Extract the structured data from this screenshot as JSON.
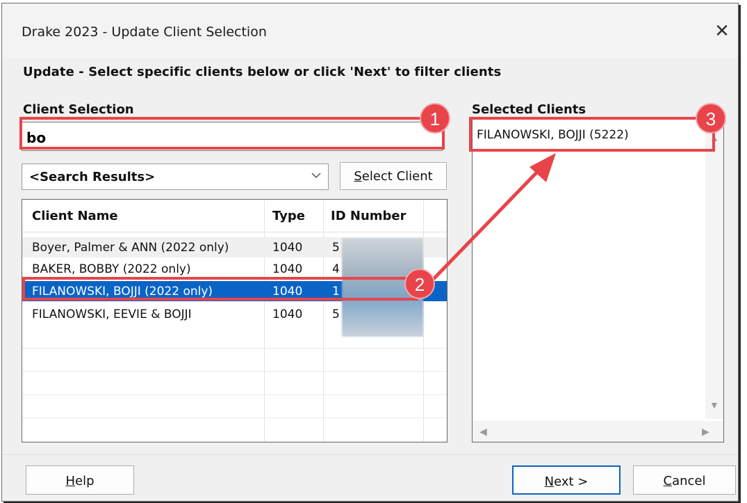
{
  "window": {
    "title": "Drake 2023 - Update Client Selection",
    "close_glyph": "✕"
  },
  "instruction": "Update - Select specific clients below or click 'Next' to filter clients",
  "client_selection": {
    "label": "Client Selection",
    "search_value": "bo",
    "filter_combo": "<Search Results>",
    "select_client_button": {
      "accel": "S",
      "rest": "elect Client"
    },
    "columns": [
      "Client Name",
      "Type",
      "ID Number"
    ],
    "rows": [
      {
        "name": "Boyer, Palmer & ANN (2022 only)",
        "type": "1040",
        "id": "5"
      },
      {
        "name": "BAKER, BOBBY (2022 only)",
        "type": "1040",
        "id": "4"
      },
      {
        "name": "FILANOWSKI, BOJJI (2022 only)",
        "type": "1040",
        "id": "1",
        "selected": true
      },
      {
        "name": "FILANOWSKI, EEVIE & BOJJI",
        "type": "1040",
        "id": "5"
      }
    ]
  },
  "selected_clients": {
    "label": "Selected Clients",
    "items": [
      "FILANOWSKI, BOJJI (5222)"
    ]
  },
  "buttons": {
    "help": {
      "accel": "H",
      "rest": "elp"
    },
    "next": {
      "accel": "N",
      "rest": "ext >"
    },
    "cancel": {
      "accel": "C",
      "rest": "ancel"
    }
  },
  "annotations": {
    "badge1": "1",
    "badge2": "2",
    "badge3": "3",
    "color": "#e8444a"
  },
  "icons": [
    "close-icon",
    "chevron-down-icon",
    "scroll-up-icon",
    "scroll-down-icon",
    "scroll-left-icon",
    "scroll-right-icon"
  ]
}
